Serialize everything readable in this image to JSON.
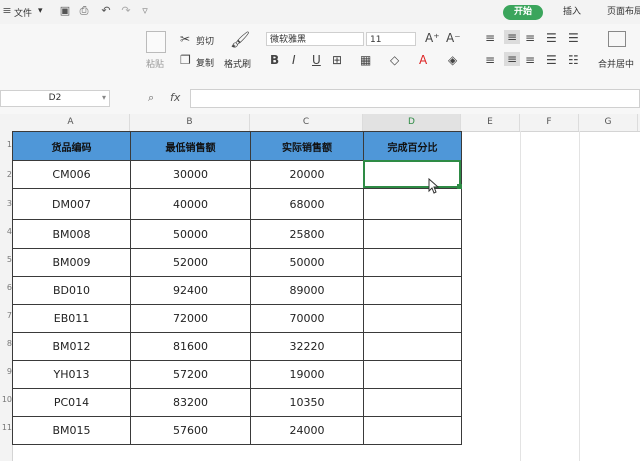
{
  "menu": {
    "file_label": "文件",
    "dropdown": "▾"
  },
  "tabs": [
    "开始",
    "插入",
    "页面布局"
  ],
  "ribbon": {
    "cut": "剪切",
    "copy": "复制",
    "paste": "粘贴",
    "format_painter": "格式刷",
    "font_name": "微软雅黑",
    "font_size": "11",
    "merge_center": "合并居中"
  },
  "formula_bar": {
    "name_box": "D2",
    "fx": "fx",
    "formula": ""
  },
  "columns": [
    "A",
    "B",
    "C",
    "D",
    "E",
    "F",
    "G"
  ],
  "row_numbers": [
    "1",
    "2",
    "3",
    "4",
    "5",
    "6",
    "7",
    "8",
    "9",
    "10",
    "11"
  ],
  "table": {
    "headers": [
      "货品编码",
      "最低销售额",
      "实际销售额",
      "完成百分比"
    ],
    "rows": [
      [
        "CM006",
        "30000",
        "20000",
        ""
      ],
      [
        "DM007",
        "40000",
        "68000",
        ""
      ],
      [
        "BM008",
        "50000",
        "25800",
        ""
      ],
      [
        "BM009",
        "52000",
        "50000",
        ""
      ],
      [
        "BD010",
        "92400",
        "89000",
        ""
      ],
      [
        "EB011",
        "72000",
        "70000",
        ""
      ],
      [
        "BM012",
        "81600",
        "32220",
        ""
      ],
      [
        "YH013",
        "57200",
        "19000",
        ""
      ],
      [
        "PC014",
        "83200",
        "10350",
        ""
      ],
      [
        "BM015",
        "57600",
        "24000",
        ""
      ]
    ]
  },
  "colors": {
    "header_fill": "#4f97d8",
    "selection": "#2e8b45",
    "active_tab": "#3ba55c"
  }
}
